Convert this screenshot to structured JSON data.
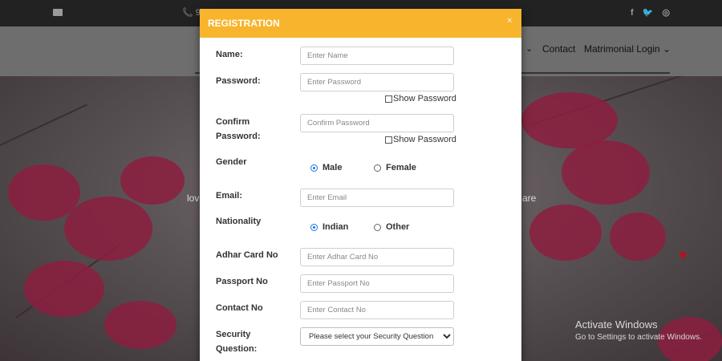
{
  "topbar": {
    "phone_text": "📞 9",
    "social_icons": [
      "facebook-icon",
      "twitter-icon",
      "instagram-icon"
    ],
    "social_glyphs": [
      "f",
      "🐦",
      "◎"
    ]
  },
  "nav": {
    "contact": "Contact",
    "matrimonial_login": "Matrimonial Login ⌄",
    "chevron": "⌄"
  },
  "hero": {
    "left_text": "lov",
    "right_text": "are"
  },
  "watermark": {
    "title": "Activate Windows",
    "subtitle": "Go to Settings to activate Windows."
  },
  "modal": {
    "title": "REGISTRATION",
    "close": "×",
    "fields": {
      "name": {
        "label": "Name:",
        "placeholder": "Enter Name"
      },
      "password": {
        "label": "Password:",
        "placeholder": "Enter Password",
        "show": "Show Password"
      },
      "confirm": {
        "label_line1": "Confirm",
        "label_line2": "Password:",
        "placeholder": "Confirm Password",
        "show": "Show Password"
      },
      "gender": {
        "label": "Gender",
        "options": [
          "Male",
          "Female"
        ],
        "selected": "Male"
      },
      "email": {
        "label": "Email:",
        "placeholder": "Enter Email"
      },
      "nationality": {
        "label": "Nationality",
        "options": [
          "Indian",
          "Other"
        ],
        "selected": "Indian"
      },
      "adhar": {
        "label": "Adhar Card No",
        "placeholder": "Enter Adhar Card No"
      },
      "passport": {
        "label": "Passport No",
        "placeholder": "Enter Passport No"
      },
      "contact": {
        "label": "Contact No",
        "placeholder": "Enter Contact No"
      },
      "security": {
        "label_line1": "Security",
        "label_line2": "Question:",
        "selected": "Please select your Security Question"
      }
    }
  },
  "colors": {
    "modal_header": "#f7b42c",
    "radio_selected": "#1a73e8"
  }
}
